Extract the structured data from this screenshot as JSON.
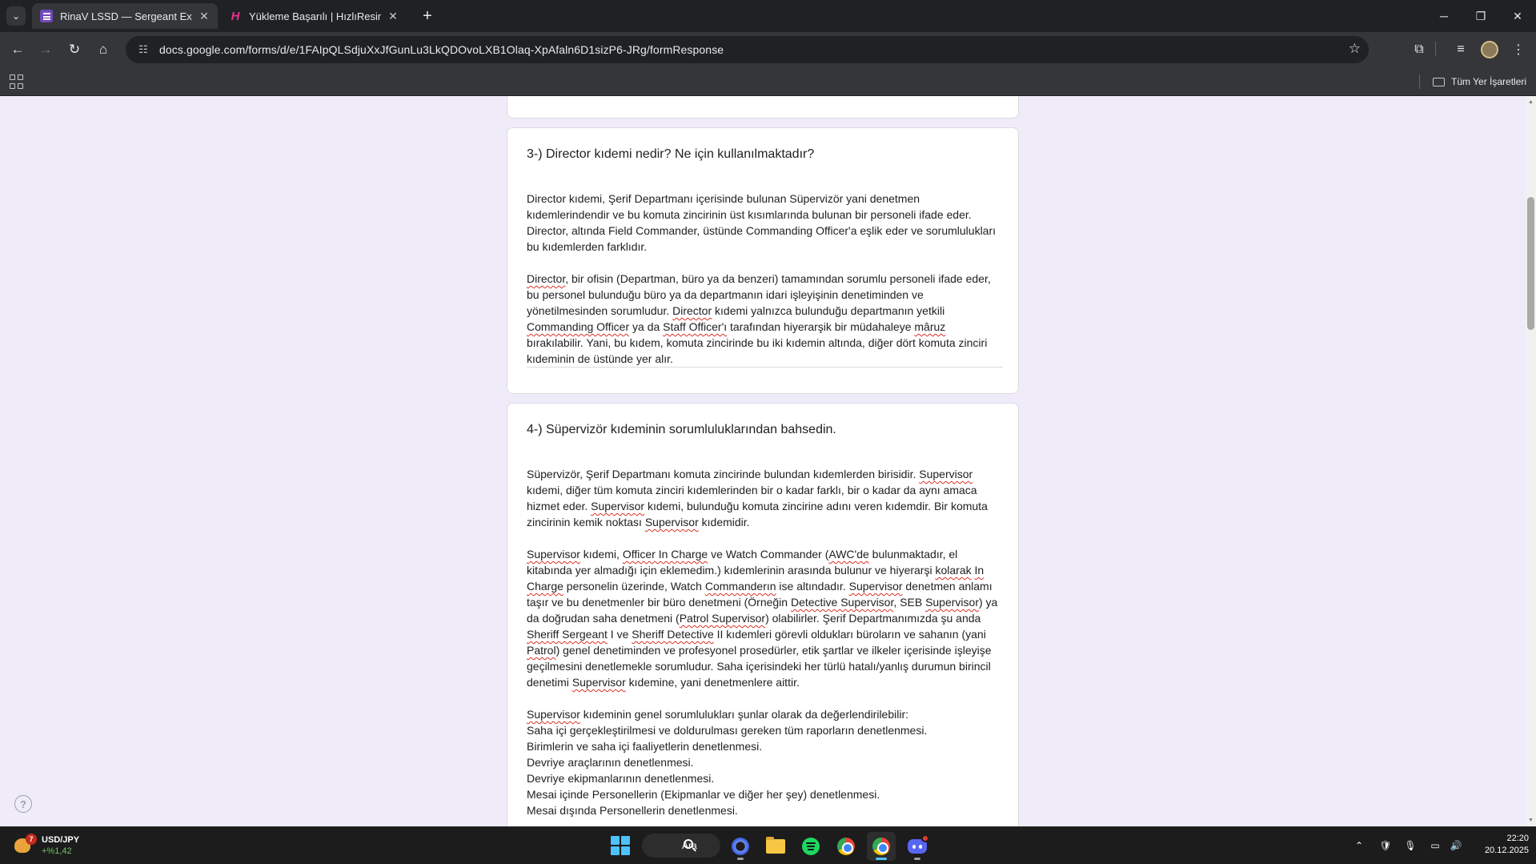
{
  "browser": {
    "tabs": [
      {
        "title": "RinaV LSSD — Sergeant Exam",
        "active": true
      },
      {
        "title": "Yükleme Başarılı | HızlıResim",
        "active": false
      }
    ],
    "url": "docs.google.com/forms/d/e/1FAIpQLSdjuXxJfGunLu3LkQDOvoLXB1Olaq-XpAfaln6D1sizP6-JRg/formResponse",
    "bookmarks_label": "Tüm Yer İşaretleri"
  },
  "form": {
    "q3": {
      "title": "3-) Director kıdemi nedir? Ne için kullanılmaktadır?",
      "answer": [
        [
          {
            "t": "Director kıdemi, Şerif Departmanı içerisinde bulunan Süpervizör yani denetmen kıdemlerindendir ve bu komuta zincirinin üst kısımlarında bulunan bir personeli ifade eder. Director, altında Field Commander, üstünde Commanding Officer'a eşlik eder ve sorumlulukları bu kıdemlerden farklıdır."
          }
        ],
        [
          {
            "t": "Director",
            "sq": true
          },
          {
            "t": ", bir ofisin (Departman, büro ya da benzeri) tamamından sorumlu personeli ifade eder, bu personel bulunduğu büro ya da departmanın idari işleyişinin denetiminden ve yönetilmesinden sorumludur. "
          },
          {
            "t": "Director",
            "sq": true
          },
          {
            "t": " kıdemi yalnızca bulunduğu departmanın yetkili "
          },
          {
            "t": "Commanding Officer",
            "sq": true
          },
          {
            "t": " ya da "
          },
          {
            "t": "Staff Officer'ı",
            "sq": true
          },
          {
            "t": " tarafından hiyerarşik bir müdahaleye "
          },
          {
            "t": "mâruz",
            "sq": true
          },
          {
            "t": " bırakılabilir. Yani, bu kıdem, komuta zincirinde bu iki kıdemin altında, diğer dört komuta zinciri kıdeminin de üstünde yer alır."
          }
        ]
      ]
    },
    "q4": {
      "title": "4-) Süpervizör kıdeminin sorumluluklarından bahsedin.",
      "answer": [
        [
          {
            "t": "Süpervizör, Şerif Departmanı komuta zincirinde bulundan kıdemlerden birisidir. "
          },
          {
            "t": "Supervisor",
            "sq": true
          },
          {
            "t": " kıdemi, diğer tüm komuta zinciri kıdemlerinden bir o kadar farklı, bir o kadar da aynı amaca hizmet eder. "
          },
          {
            "t": "Supervisor",
            "sq": true
          },
          {
            "t": " kıdemi, bulunduğu komuta zincirine adını veren kıdemdir. Bir komuta zincirinin kemik noktası "
          },
          {
            "t": "Supervisor",
            "sq": true
          },
          {
            "t": " kıdemidir."
          }
        ],
        [
          {
            "t": "Supervisor",
            "sq": true
          },
          {
            "t": " kıdemi, "
          },
          {
            "t": "Officer In Charge",
            "sq": true
          },
          {
            "t": " ve Watch Commander ("
          },
          {
            "t": "AWC'de",
            "sq": true
          },
          {
            "t": " bulunmaktadır, el kitabında yer almadığı için eklemedim.) kıdemlerinin arasında bulunur ve hiyerarşi "
          },
          {
            "t": "kolarak",
            "sq": true
          },
          {
            "t": " "
          },
          {
            "t": "In Charge",
            "sq": true
          },
          {
            "t": " personelin üzerinde, Watch "
          },
          {
            "t": "Commanderın",
            "sq": true
          },
          {
            "t": " ise altındadır. "
          },
          {
            "t": "Supervisor",
            "sq": true
          },
          {
            "t": " denetmen anlamı taşır ve bu denetmenler bir büro denetmeni (Örneğin "
          },
          {
            "t": "Detective Supervisor",
            "sq": true
          },
          {
            "t": ", SEB "
          },
          {
            "t": "Supervisor",
            "sq": true
          },
          {
            "t": ") ya da doğrudan saha denetmeni ("
          },
          {
            "t": "Patrol Supervisor",
            "sq": true
          },
          {
            "t": ") olabilirler. Şerif Departmanımızda şu anda "
          },
          {
            "t": "Sheriff Sergeant",
            "sq": true
          },
          {
            "t": " I ve "
          },
          {
            "t": "Sheriff Detective",
            "sq": true
          },
          {
            "t": " II kıdemleri görevli oldukları büroların ve sahanın (yani "
          },
          {
            "t": "Patrol",
            "sq": true
          },
          {
            "t": ") genel denetiminden ve profesyonel prosedürler, etik şartlar ve ilkeler içerisinde işleyişe geçilmesini denetlemekle sorumludur. Saha içerisindeki her türlü hatalı/yanlış durumun birincil denetimi "
          },
          {
            "t": "Supervisor",
            "sq": true
          },
          {
            "t": " kıdemine, yani denetmenlere aittir."
          }
        ],
        [
          {
            "t": "Supervisor",
            "sq": true
          },
          {
            "t": " kıdeminin genel sorumlulukları şunlar olarak da değerlendirilebilir:\nSaha içi gerçekleştirilmesi ve doldurulması gereken tüm raporların denetlenmesi.\nBirimlerin ve saha içi faaliyetlerin denetlenmesi.\nDevriye araçlarının denetlenmesi.\nDevriye ekipmanlarının denetlenmesi.\nMesai içinde Personellerin (Ekipmanlar ve diğer her şey) denetlenmesi.\nMesai dışında Personellerin denetlenmesi."
          }
        ]
      ]
    }
  },
  "taskbar": {
    "widget_pair": "USD/JPY",
    "widget_change": "+%1,42",
    "widget_badge": "7",
    "search_label": "Ara",
    "time": "22:20",
    "date": "20.12.2025"
  }
}
